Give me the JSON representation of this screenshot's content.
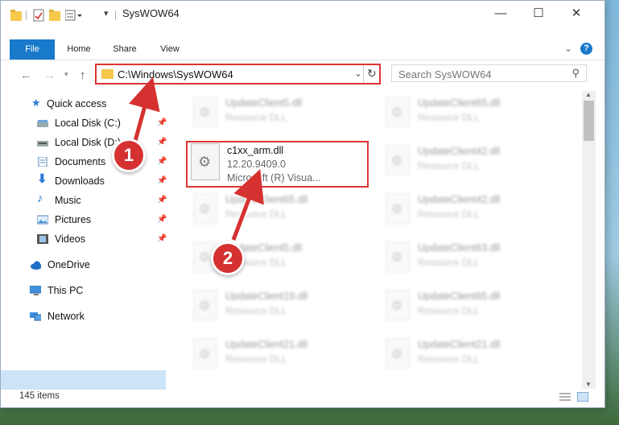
{
  "window": {
    "title": "SysWOW64"
  },
  "ribbon": {
    "tabs": [
      "File",
      "Home",
      "Share",
      "View"
    ],
    "help": "?"
  },
  "address": {
    "path": "C:\\Windows\\SysWOW64"
  },
  "search": {
    "placeholder": "Search SysWOW64"
  },
  "sidebar": {
    "quick_access": "Quick access",
    "items": [
      "Local Disk (C:)",
      "Local Disk (D:)",
      "Documents",
      "Downloads",
      "Music",
      "Pictures",
      "Videos"
    ],
    "onedrive": "OneDrive",
    "thispc": "This PC",
    "network": "Network"
  },
  "files": {
    "focused": {
      "name": "c1xx_arm.dll",
      "version": "12.20.9409.0",
      "company": "Microsoft (R) Visua..."
    },
    "type_label": "Resource DLL",
    "left_column": [
      "UpdateClient5.dll",
      "UpdateClient65.dll",
      "UpdateClient5.dll",
      "UpdateClient19.dll",
      "UpdateClient21.dll"
    ],
    "right_column": [
      "UpdateClient65.dll",
      "UpdateClient42.dll",
      "UpdateClient42.dll",
      "UpdateClient63.dll",
      "UpdateClient65.dll",
      "UpdateClient21.dll"
    ]
  },
  "status": {
    "count": "145 items"
  },
  "annotations": {
    "step1": "1",
    "step2": "2",
    "color": "#d63131"
  }
}
